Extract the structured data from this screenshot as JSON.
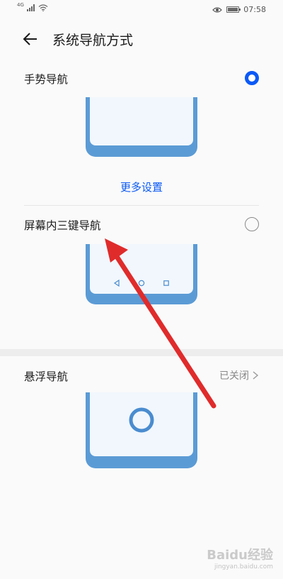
{
  "status_bar": {
    "network": "4G",
    "time": "07:58"
  },
  "header": {
    "title": "系统导航方式"
  },
  "options": {
    "gesture": {
      "label": "手势导航",
      "selected": true
    },
    "more_settings": "更多设置",
    "three_key": {
      "label": "屏幕内三键导航",
      "selected": false
    },
    "floating": {
      "label": "悬浮导航",
      "status": "已关闭"
    }
  },
  "watermark": {
    "brand": "Baidu经验",
    "url": "jingyan.baidu.com"
  },
  "icons": {
    "back": "arrow-left-icon",
    "chevron": "chevron-right-icon",
    "nav_back": "triangle-left-icon",
    "nav_home": "circle-icon",
    "nav_recent": "square-icon"
  },
  "colors": {
    "accent": "#0a59f7",
    "phone_frame": "#5b9bd5",
    "phone_screen": "#f1f7fd",
    "annotation_arrow": "#e02b2b"
  }
}
